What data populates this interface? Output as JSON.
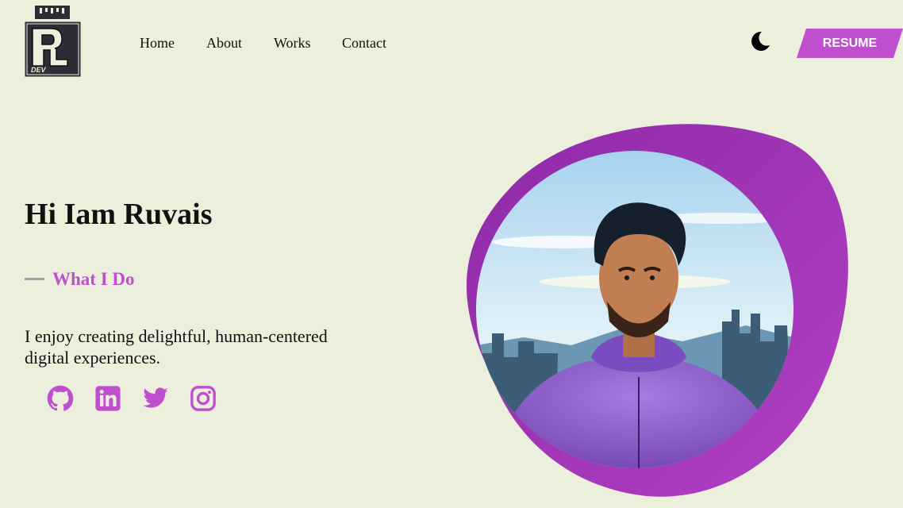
{
  "logo": {
    "letter": "R",
    "caption": "DEV"
  },
  "nav": {
    "items": [
      "Home",
      "About",
      "Works",
      "Contact"
    ]
  },
  "header": {
    "resume_label": "RESUME",
    "theme_icon": "moon-icon"
  },
  "hero": {
    "title": "Hi Iam Ruvais",
    "subtitle": "What I Do",
    "description": "I enjoy creating delightful, human-centered digital experiences."
  },
  "social": [
    "github-icon",
    "linkedin-icon",
    "twitter-icon",
    "instagram-icon"
  ],
  "colors": {
    "accent": "#c04fd0",
    "background": "#ebefdc",
    "text": "#111111"
  }
}
